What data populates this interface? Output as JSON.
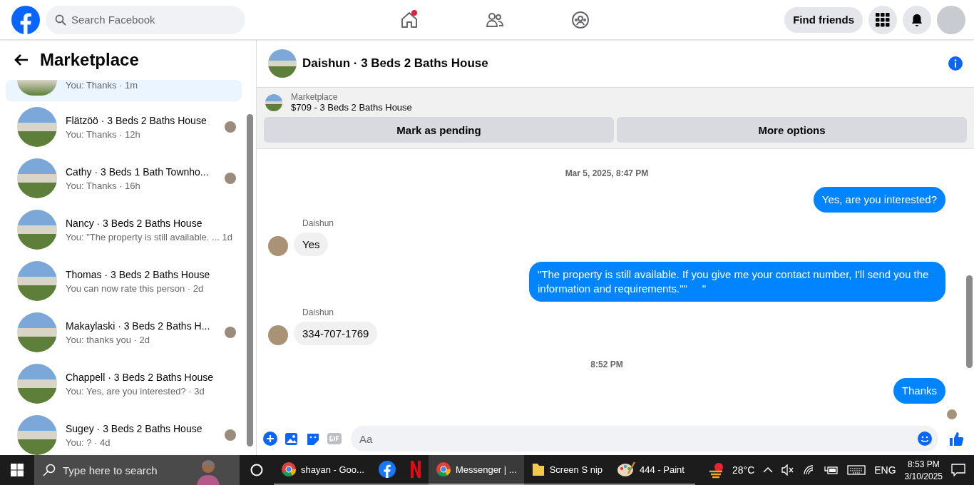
{
  "top_bar": {
    "search": {
      "placeholder": "Search Facebook"
    },
    "nav": [
      {
        "kind": "home",
        "selected": false,
        "dot": true
      },
      {
        "kind": "friends",
        "selected": false,
        "dot": false
      },
      {
        "kind": "groups",
        "selected": false,
        "dot": false
      }
    ],
    "find_friends": "Find friends"
  },
  "sidebar": {
    "title": "Marketplace",
    "conversations": [
      {
        "kind": "partial",
        "preview": "You: Thanks · 1m",
        "seen": false,
        "selected": true
      },
      {
        "kind": "full",
        "title": "Flätzöö · 3 Beds 2 Baths House",
        "preview": "You: Thanks · 12h",
        "seen": true,
        "selected": false
      },
      {
        "kind": "full",
        "title": "Cathy · 3 Beds 1 Bath Townho...",
        "preview": "You: Thanks · 16h",
        "seen": true,
        "selected": false
      },
      {
        "kind": "full",
        "title": "Nancy · 3 Beds 2 Baths House",
        "preview": "You: \"The property is still available. ...  1d",
        "seen": false,
        "selected": false
      },
      {
        "kind": "full",
        "title": "Thomas · 3 Beds 2 Baths House",
        "preview": "You can now rate this person · 2d",
        "seen": false,
        "selected": false
      },
      {
        "kind": "full",
        "title": "Makaylaski · 3 Beds 2 Baths H...",
        "preview": "You: thanks you · 2d",
        "seen": true,
        "selected": false
      },
      {
        "kind": "full",
        "title": "Chappell · 3 Beds 2 Baths House",
        "preview": "You: Yes, are you interested? · 3d",
        "seen": false,
        "selected": false
      },
      {
        "kind": "full",
        "title": "Sugey · 3 Beds 2 Baths House",
        "preview": "You: ? · 4d",
        "seen": true,
        "selected": false
      }
    ]
  },
  "chat": {
    "title": "Daishun · 3 Beds 2 Baths House",
    "listing": {
      "label": "Marketplace",
      "price_title": "$709 - 3 Beds 2 Baths House",
      "buttons": [
        "Mark as pending",
        "More options"
      ]
    },
    "messages": [
      {
        "kind": "timestamp",
        "text": "Mar 5, 2025, 8:47 PM"
      },
      {
        "kind": "outgoing",
        "text": "Yes, are you interested?"
      },
      {
        "kind": "incoming",
        "sender": "Daishun",
        "text": "Yes"
      },
      {
        "kind": "outgoing",
        "text": "\"The property is still available. If you give me your contact number, I'll send you the information and requirements.\"\"     \""
      },
      {
        "kind": "incoming",
        "sender": "Daishun",
        "text": "334-707-1769"
      },
      {
        "kind": "timestamp",
        "text": "8:52 PM"
      },
      {
        "kind": "outgoing",
        "text": "Thanks"
      }
    ],
    "seen": true,
    "composer": {
      "placeholder": "Aa"
    }
  },
  "taskbar": {
    "search": {
      "placeholder": "Type here to search"
    },
    "apps": [
      {
        "kind": "chrome",
        "label": "shayan - Goo...",
        "selected": false
      },
      {
        "kind": "facebook",
        "selected": false
      },
      {
        "kind": "netflix",
        "selected": false
      },
      {
        "kind": "chrome",
        "label": "Messenger | ...",
        "selected": true
      },
      {
        "kind": "folder",
        "label": "Screen S nip",
        "selected": false
      },
      {
        "kind": "paint",
        "label": "444 - Paint",
        "selected": false
      }
    ],
    "weather": "28°C",
    "language": "ENG",
    "time": "8:53 PM",
    "date": "3/10/2025"
  }
}
